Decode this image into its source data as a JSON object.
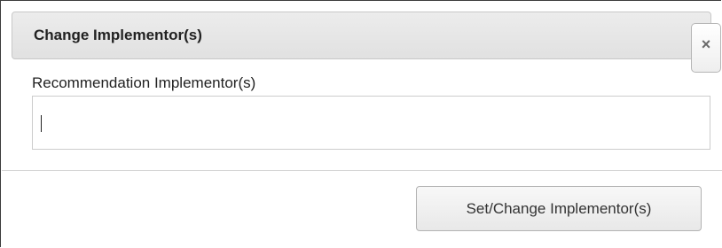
{
  "dialog": {
    "title": "Change Implementor(s)",
    "close_icon": "close-icon",
    "close_glyph": "×"
  },
  "form": {
    "field_label": "Recommendation Implementor(s)",
    "field_value": "",
    "field_placeholder": ""
  },
  "actions": {
    "submit_label": "Set/Change Implementor(s)"
  },
  "colors": {
    "titlebar_bg": "#e6e6e6",
    "border": "#c8c8c8",
    "text": "#222222"
  }
}
